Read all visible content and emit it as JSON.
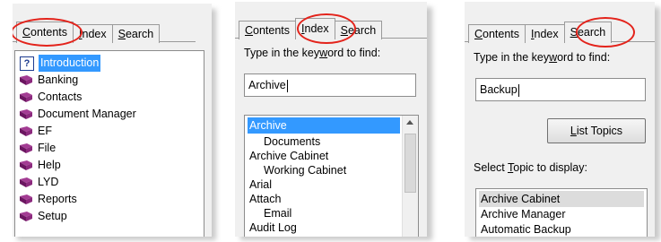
{
  "contents_panel": {
    "tabs": [
      {
        "prefix": "",
        "ul": "C",
        "suffix": "ontents"
      },
      {
        "prefix": "",
        "ul": "I",
        "suffix": "ndex"
      },
      {
        "prefix": "",
        "ul": "S",
        "suffix": "earch"
      }
    ],
    "items": [
      {
        "label": "Introduction",
        "icon": "help-page-icon",
        "selected": true
      },
      {
        "label": "Banking",
        "icon": "book-icon"
      },
      {
        "label": "Contacts",
        "icon": "book-icon"
      },
      {
        "label": "Document Manager",
        "icon": "book-icon"
      },
      {
        "label": "EF",
        "icon": "book-icon"
      },
      {
        "label": "File",
        "icon": "book-icon"
      },
      {
        "label": "Help",
        "icon": "book-icon"
      },
      {
        "label": "LYD",
        "icon": "book-icon"
      },
      {
        "label": "Reports",
        "icon": "book-icon"
      },
      {
        "label": "Setup",
        "icon": "book-icon"
      }
    ],
    "help_icon_glyph": "?"
  },
  "index_panel": {
    "tabs": [
      {
        "prefix": "",
        "ul": "C",
        "suffix": "ontents"
      },
      {
        "prefix": "",
        "ul": "I",
        "suffix": "ndex"
      },
      {
        "prefix": "",
        "ul": "S",
        "suffix": "earch"
      }
    ],
    "prompt": {
      "prefix": "Type in the key",
      "ul": "w",
      "suffix": "ord to find:"
    },
    "search_value": "Archive",
    "list": [
      {
        "label": "Archive",
        "selected": true,
        "indent": 0
      },
      {
        "label": "Documents",
        "indent": 1
      },
      {
        "label": "Archive Cabinet",
        "indent": 0
      },
      {
        "label": "Working Cabinet",
        "indent": 1
      },
      {
        "label": "Arial",
        "indent": 0
      },
      {
        "label": "Attach",
        "indent": 0
      },
      {
        "label": "Email",
        "indent": 1
      },
      {
        "label": "Audit Log",
        "indent": 0
      }
    ]
  },
  "search_panel": {
    "tabs": [
      {
        "prefix": "",
        "ul": "C",
        "suffix": "ontents"
      },
      {
        "prefix": "",
        "ul": "I",
        "suffix": "ndex"
      },
      {
        "prefix": "",
        "ul": "S",
        "suffix": "earch"
      }
    ],
    "prompt": {
      "prefix": "Type in the key",
      "ul": "w",
      "suffix": "ord to find:"
    },
    "search_value": "Backup",
    "list_topics_button": {
      "prefix": "",
      "ul": "L",
      "suffix": "ist Topics"
    },
    "select_topic_label": {
      "prefix": "Select ",
      "ul": "T",
      "suffix": "opic to display:"
    },
    "topics": [
      {
        "label": "Archive Cabinet",
        "selected": true
      },
      {
        "label": "Archive Manager"
      },
      {
        "label": "Automatic Backup"
      }
    ]
  },
  "colors": {
    "highlight_ring": "#e3231b",
    "selection": "#3399ff",
    "book": "#7b1f6e"
  }
}
